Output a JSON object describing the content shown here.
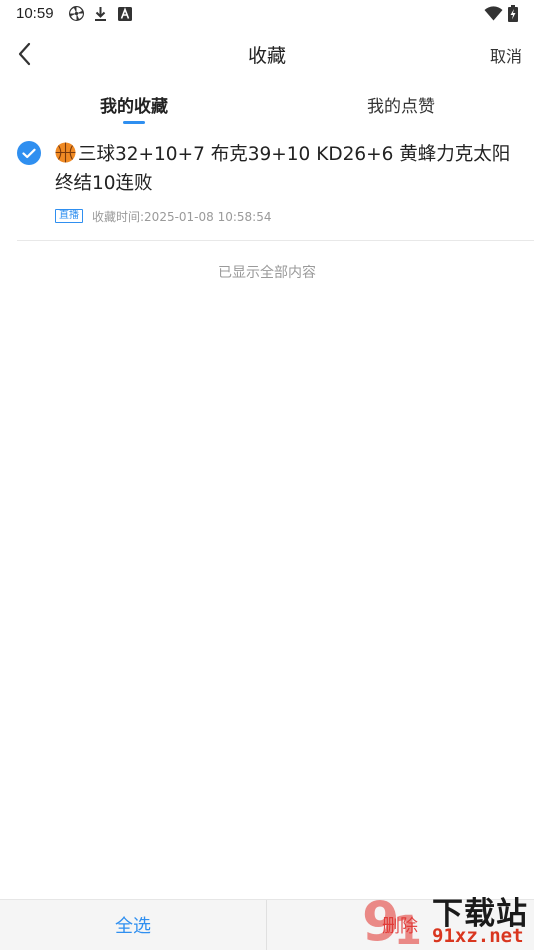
{
  "status_bar": {
    "time": "10:59",
    "icons": [
      "pinwheel-icon",
      "download-icon",
      "font-a-icon",
      "wifi-icon",
      "battery-charging-icon"
    ]
  },
  "nav": {
    "title": "收藏",
    "cancel_label": "取消"
  },
  "tabs": [
    {
      "label": "我的收藏",
      "active": true
    },
    {
      "label": "我的点赞",
      "active": false
    }
  ],
  "favorites": [
    {
      "checked": true,
      "title": "三球32+10+7 布克39+10 KD26+6 黄蜂力克太阳终结10连败",
      "badge": "直播",
      "time_text": "收藏时间:2025-01-08 10:58:54",
      "icon": "basketball-icon"
    }
  ],
  "end_text": "已显示全部内容",
  "bottom": {
    "select_all_label": "全选",
    "delete_label": "删除"
  },
  "watermark": {
    "line1": "下载站",
    "line2": "91xz.net"
  },
  "colors": {
    "accent": "#2f8ff0",
    "delete": "#e24a4a",
    "muted": "#9a9a9a"
  }
}
